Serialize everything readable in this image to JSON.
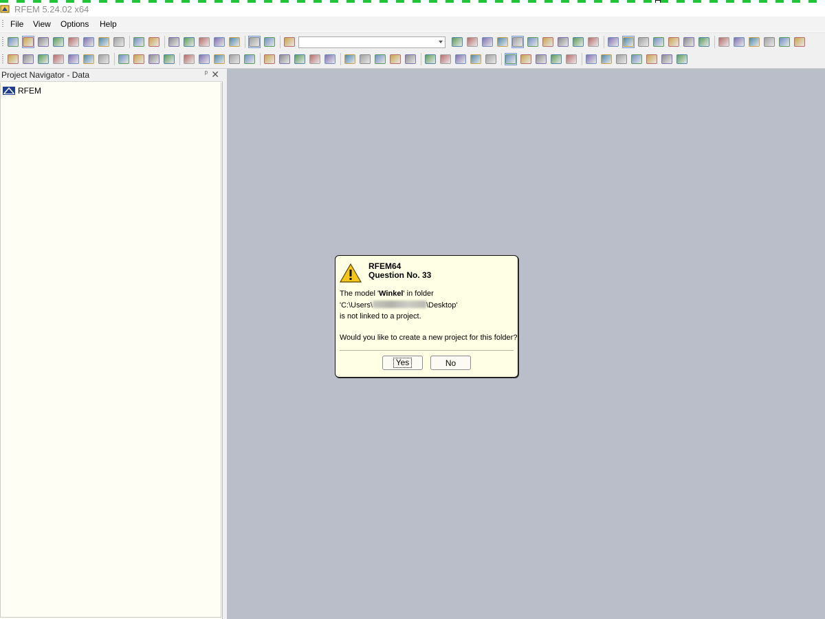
{
  "window": {
    "title": "RFEM 5.24.02 x64"
  },
  "menu": [
    "File",
    "View",
    "Options",
    "Help"
  ],
  "toolbar1": {
    "icons": [
      "new-file-icon",
      "open-folder-icon",
      "open-project-icon",
      "save-all-icon",
      "save-icon",
      "notepad-icon",
      "print-icon",
      "print-preview-icon",
      "undo-icon",
      "redo-icon",
      "edit-pencil-icon",
      "search-model-icon",
      "zoom-all-icon",
      "table-window-icon",
      "window-arrange-icon",
      "navigator-toggle-icon",
      "table-toggle-icon",
      "load-case-icon"
    ],
    "combo_value": "",
    "icons_after": [
      "previous-icon",
      "next-icon",
      "show-results-icon",
      "values-icon",
      "display-eye-icon",
      "results-values-icon",
      "deform-icon",
      "result-diagram-icon",
      "section-icon",
      "grid-icon",
      "snap-icon",
      "view-3d-icon",
      "move-icon",
      "rotate-icon",
      "mirror-icon",
      "measure-icon",
      "line-tools-icon",
      "support-icon",
      "symmetry-icon",
      "intersect-icon",
      "hinge-icon",
      "settings-icon",
      "render-icon"
    ]
  },
  "toolbar2": {
    "icons": [
      "node-icon",
      "line-icon",
      "member-icon",
      "polyline-icon",
      "material-icon",
      "section-profile-icon",
      "thickness-icon",
      "support-node-icon",
      "support-line-icon",
      "hinge-end-icon",
      "load-node-icon",
      "load-member-icon",
      "surface-icon",
      "solid-icon",
      "opening-icon",
      "load-case-manager-icon",
      "combination-icon",
      "generate-load-icon",
      "action-combo-icon",
      "calculation-icon",
      "results-icon",
      "zoom-window-icon",
      "zoom-in-icon",
      "zoom-out-icon",
      "view-iso-icon",
      "view-front-icon",
      "rotate-x-icon",
      "rotate-y-icon",
      "rotate-z-icon",
      "axis-x-icon",
      "filter-icon",
      "select-icon",
      "visibility-icon",
      "wireframe-icon",
      "solid-render-icon",
      "transparency-icon",
      "member-display-icon",
      "surface-display-icon",
      "color-scale-icon",
      "load-display-icon",
      "grid-display-icon",
      "layout-icon",
      "table-layout-icon"
    ]
  },
  "navigator": {
    "title": "Project Navigator - Data",
    "pin_glyph": "ᵖ",
    "close_glyph": "✕",
    "tree": [
      {
        "label": "RFEM",
        "icon": "rfem-app-icon"
      }
    ]
  },
  "dialog": {
    "app": "RFEM64",
    "question": "Question No. 33",
    "line1_prefix": "The model '",
    "model_name": "Winkel",
    "line1_suffix": "' in folder",
    "path_prefix": "'C:\\Users\\",
    "path_suffix": "\\Desktop'",
    "line3": "is not linked to a project.",
    "prompt": "Would you like to create a new project for this folder?",
    "yes": "Yes",
    "no": "No"
  },
  "colors": {
    "workspace": "#b9bec8",
    "navigator_bg": "#fffef5",
    "dialog_bg": "#ffffe6",
    "selection_dash": "#22c43a"
  }
}
